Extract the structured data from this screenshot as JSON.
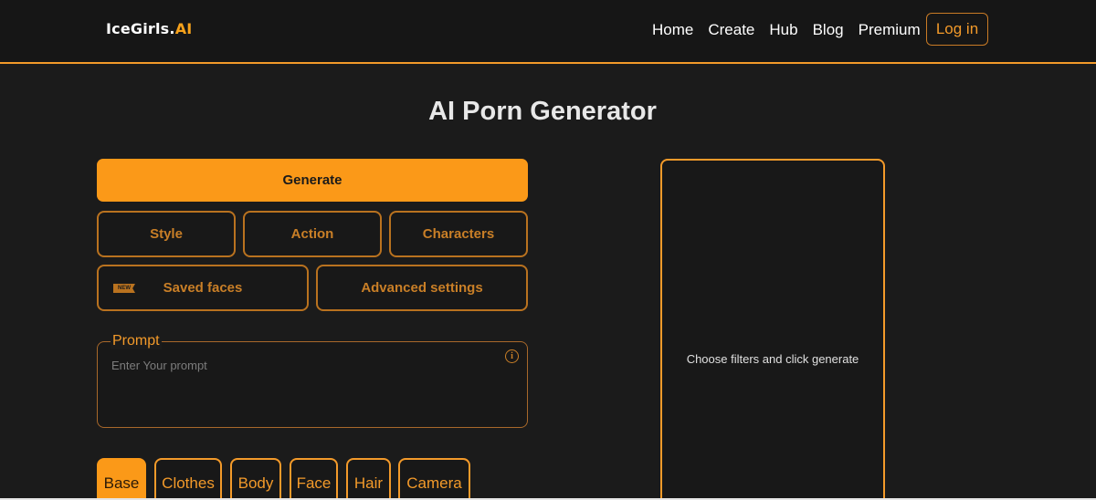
{
  "header": {
    "logo_main": "IceGirls.",
    "logo_accent": "AI",
    "nav": [
      "Home",
      "Create",
      "Hub",
      "Blog",
      "Premium"
    ],
    "login_label": "Log in"
  },
  "page": {
    "title": "AI Porn Generator"
  },
  "controls": {
    "generate_label": "Generate",
    "style_label": "Style",
    "action_label": "Action",
    "characters_label": "Characters",
    "saved_faces_label": "Saved faces",
    "new_badge": "NEW",
    "advanced_label": "Advanced settings"
  },
  "prompt": {
    "label": "Prompt",
    "placeholder": "Enter Your prompt",
    "value": "",
    "info_icon": "i"
  },
  "tabs": [
    {
      "label": "Base",
      "active": true
    },
    {
      "label": "Clothes",
      "active": false
    },
    {
      "label": "Body",
      "active": false
    },
    {
      "label": "Face",
      "active": false
    },
    {
      "label": "Hair",
      "active": false
    },
    {
      "label": "Camera",
      "active": false
    }
  ],
  "preview": {
    "empty_text": "Choose filters and click generate"
  },
  "colors": {
    "accent": "#fb9918",
    "accent_muted": "#b9721f",
    "background": "#1b1b1b"
  }
}
